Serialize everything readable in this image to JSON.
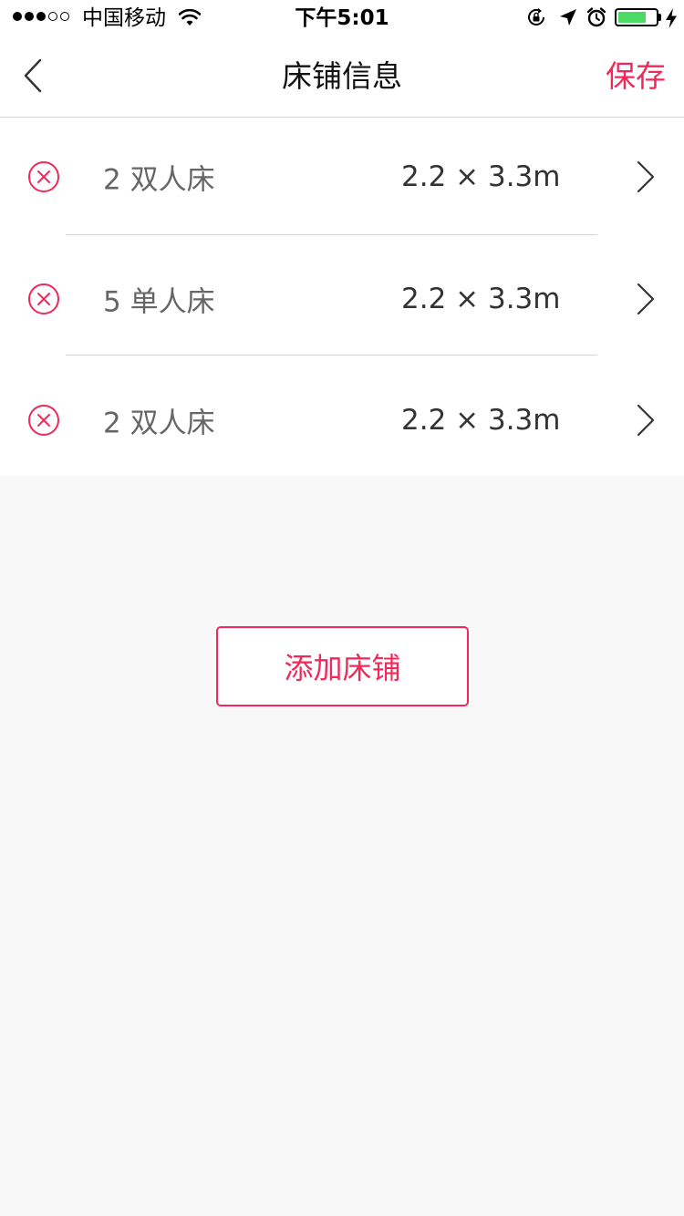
{
  "status_bar": {
    "carrier": "中国移动",
    "time": "下午5:01",
    "signal_dots_filled": 3,
    "signal_dots_total": 5,
    "battery_level": 0.75,
    "battery_color": "#4cd964",
    "icons": [
      "wifi-icon",
      "rotation-lock-icon",
      "location-icon",
      "alarm-icon",
      "battery-icon",
      "charging-icon"
    ]
  },
  "nav": {
    "title": "床铺信息",
    "save_label": "保存",
    "back_icon": "chevron-left-icon"
  },
  "beds": [
    {
      "type": "2 双人床",
      "size": "2.2 × 3.3m"
    },
    {
      "type": "5 单人床",
      "size": "2.2 × 3.3m"
    },
    {
      "type": "2 双人床",
      "size": "2.2 × 3.3m"
    }
  ],
  "row_icons": {
    "remove": "remove-circle-icon",
    "open": "chevron-right-icon"
  },
  "add_button_label": "添加床铺",
  "colors": {
    "accent": "#f0295a",
    "background": "#f8f8f8",
    "divider": "#d4d4d4"
  }
}
